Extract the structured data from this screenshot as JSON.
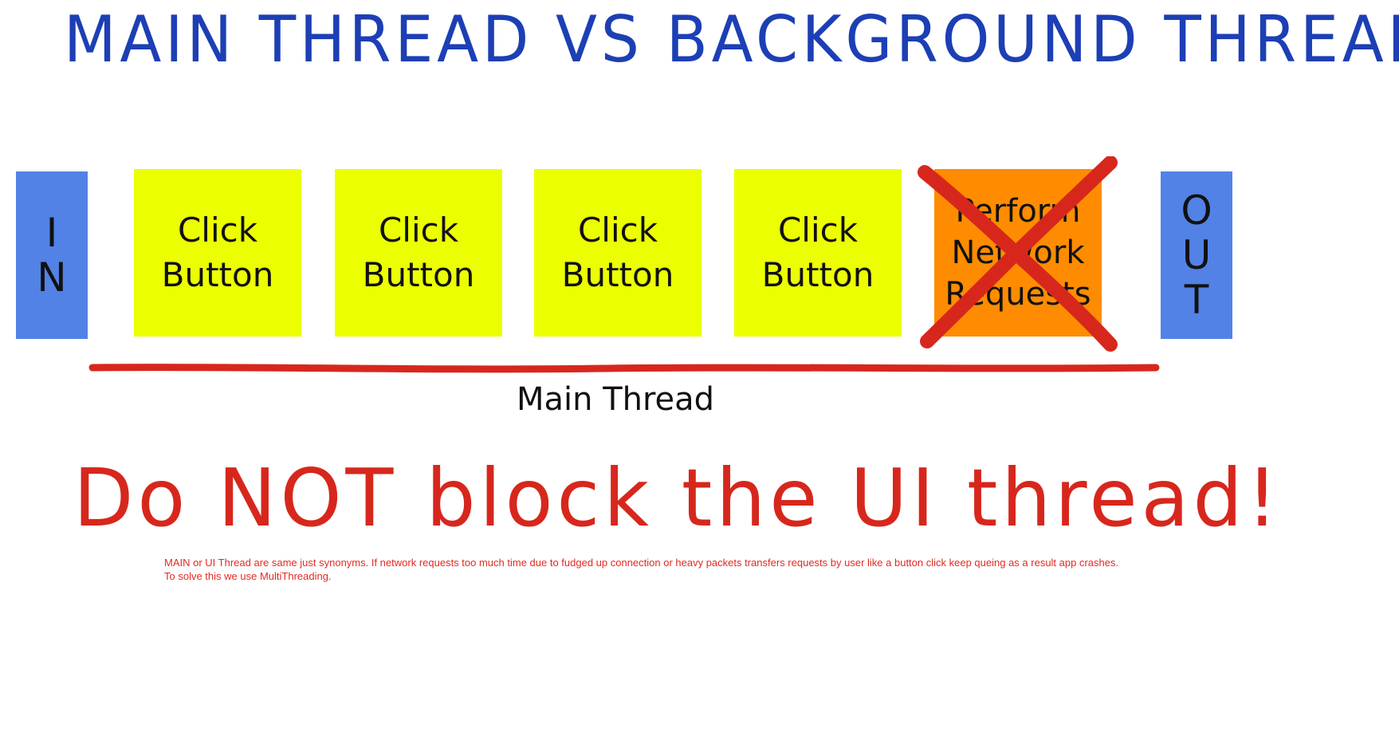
{
  "title": "MAIN THREAD VS BACKGROUND THREAD",
  "input": {
    "label_lines": [
      "I",
      "N"
    ]
  },
  "output": {
    "label_lines": [
      "O",
      "U",
      "T"
    ]
  },
  "tasks": [
    {
      "label": "Click\nButton"
    },
    {
      "label": "Click\nButton"
    },
    {
      "label": "Click\nButton"
    },
    {
      "label": "Click\nButton"
    },
    {
      "label": "Perform\nNetwork\nRequests",
      "blocked": true
    }
  ],
  "thread_label": "Main Thread",
  "warning": "Do NOT block the UI thread!",
  "note_lines": [
    "MAIN or UI Thread are same just synonyms. If network requests too much time due to fudged up connection or heavy packets transfers requests by user like a button click keep queing as a result app crashes.",
    "To solve this we use MultiThreading."
  ],
  "colors": {
    "title": "#1d3fb5",
    "io_box": "#5282e6",
    "task_box": "#ecff00",
    "blocked_task_box": "#ff8c00",
    "thread_line": "#d7271d",
    "cross": "#d7271d",
    "warning": "#d7271d",
    "note": "#e22a22"
  }
}
